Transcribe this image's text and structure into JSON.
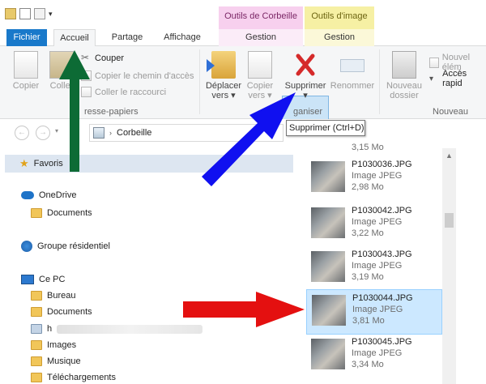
{
  "titlebar": {
    "contextual": [
      {
        "header": "Outils de Corbeille",
        "color": "#f7d0ee"
      },
      {
        "header": "Outils d'image",
        "color": "#f6f0a4"
      }
    ]
  },
  "tabs": {
    "file": "Fichier",
    "home": "Accueil",
    "share": "Partage",
    "view": "Affichage",
    "manage1": "Gestion",
    "manage2": "Gestion"
  },
  "ribbon": {
    "copy": "Copier",
    "paste": "Coller",
    "cut": "Couper",
    "copy_path": "Copier le chemin d'accès",
    "paste_shortcut": "Coller le raccourci",
    "clipboard_group": "resse-papiers",
    "move_to_l1": "Déplacer",
    "move_to_l2": "vers",
    "copy_to_l1": "Copier",
    "copy_to_l2": "vers",
    "delete": "Supprimer",
    "rename": "Renommer",
    "organize_group": "ganiser",
    "new_folder_l1": "Nouveau",
    "new_folder_l2": "dossier",
    "new_item": "Nouvel élém",
    "easy_access": "Accès rapid",
    "new_group": "Nouveau"
  },
  "tooltip": "Supprimer (Ctrl+D)",
  "address": {
    "location": "Corbeille"
  },
  "nav_pane": {
    "favorites": "Favoris",
    "onedrive": "OneDrive",
    "documents_od": "Documents",
    "homegroup": "Groupe résidentiel",
    "this_pc": "Ce PC",
    "items": [
      "Bureau",
      "Documents",
      "Images",
      "Musique",
      "Téléchargements"
    ],
    "user_folder_prefix": "h"
  },
  "files": {
    "top_fragment": "3,15 Mo",
    "items": [
      {
        "name": "P1030036.JPG",
        "type": "Image JPEG",
        "size": "2,98 Mo"
      },
      {
        "name": "P1030042.JPG",
        "type": "Image JPEG",
        "size": "3,22 Mo"
      },
      {
        "name": "P1030043.JPG",
        "type": "Image JPEG",
        "size": "3,19 Mo"
      },
      {
        "name": "P1030044.JPG",
        "type": "Image JPEG",
        "size": "3,81 Mo",
        "selected": true
      },
      {
        "name": "P1030045.JPG",
        "type": "Image JPEG",
        "size": "3,34 Mo"
      }
    ]
  },
  "colors": {
    "file_tab": "#1979ca",
    "selection": "#cce8ff",
    "arrow_green": "#0d6b35",
    "arrow_blue": "#1010f0",
    "arrow_red": "#e41010"
  }
}
